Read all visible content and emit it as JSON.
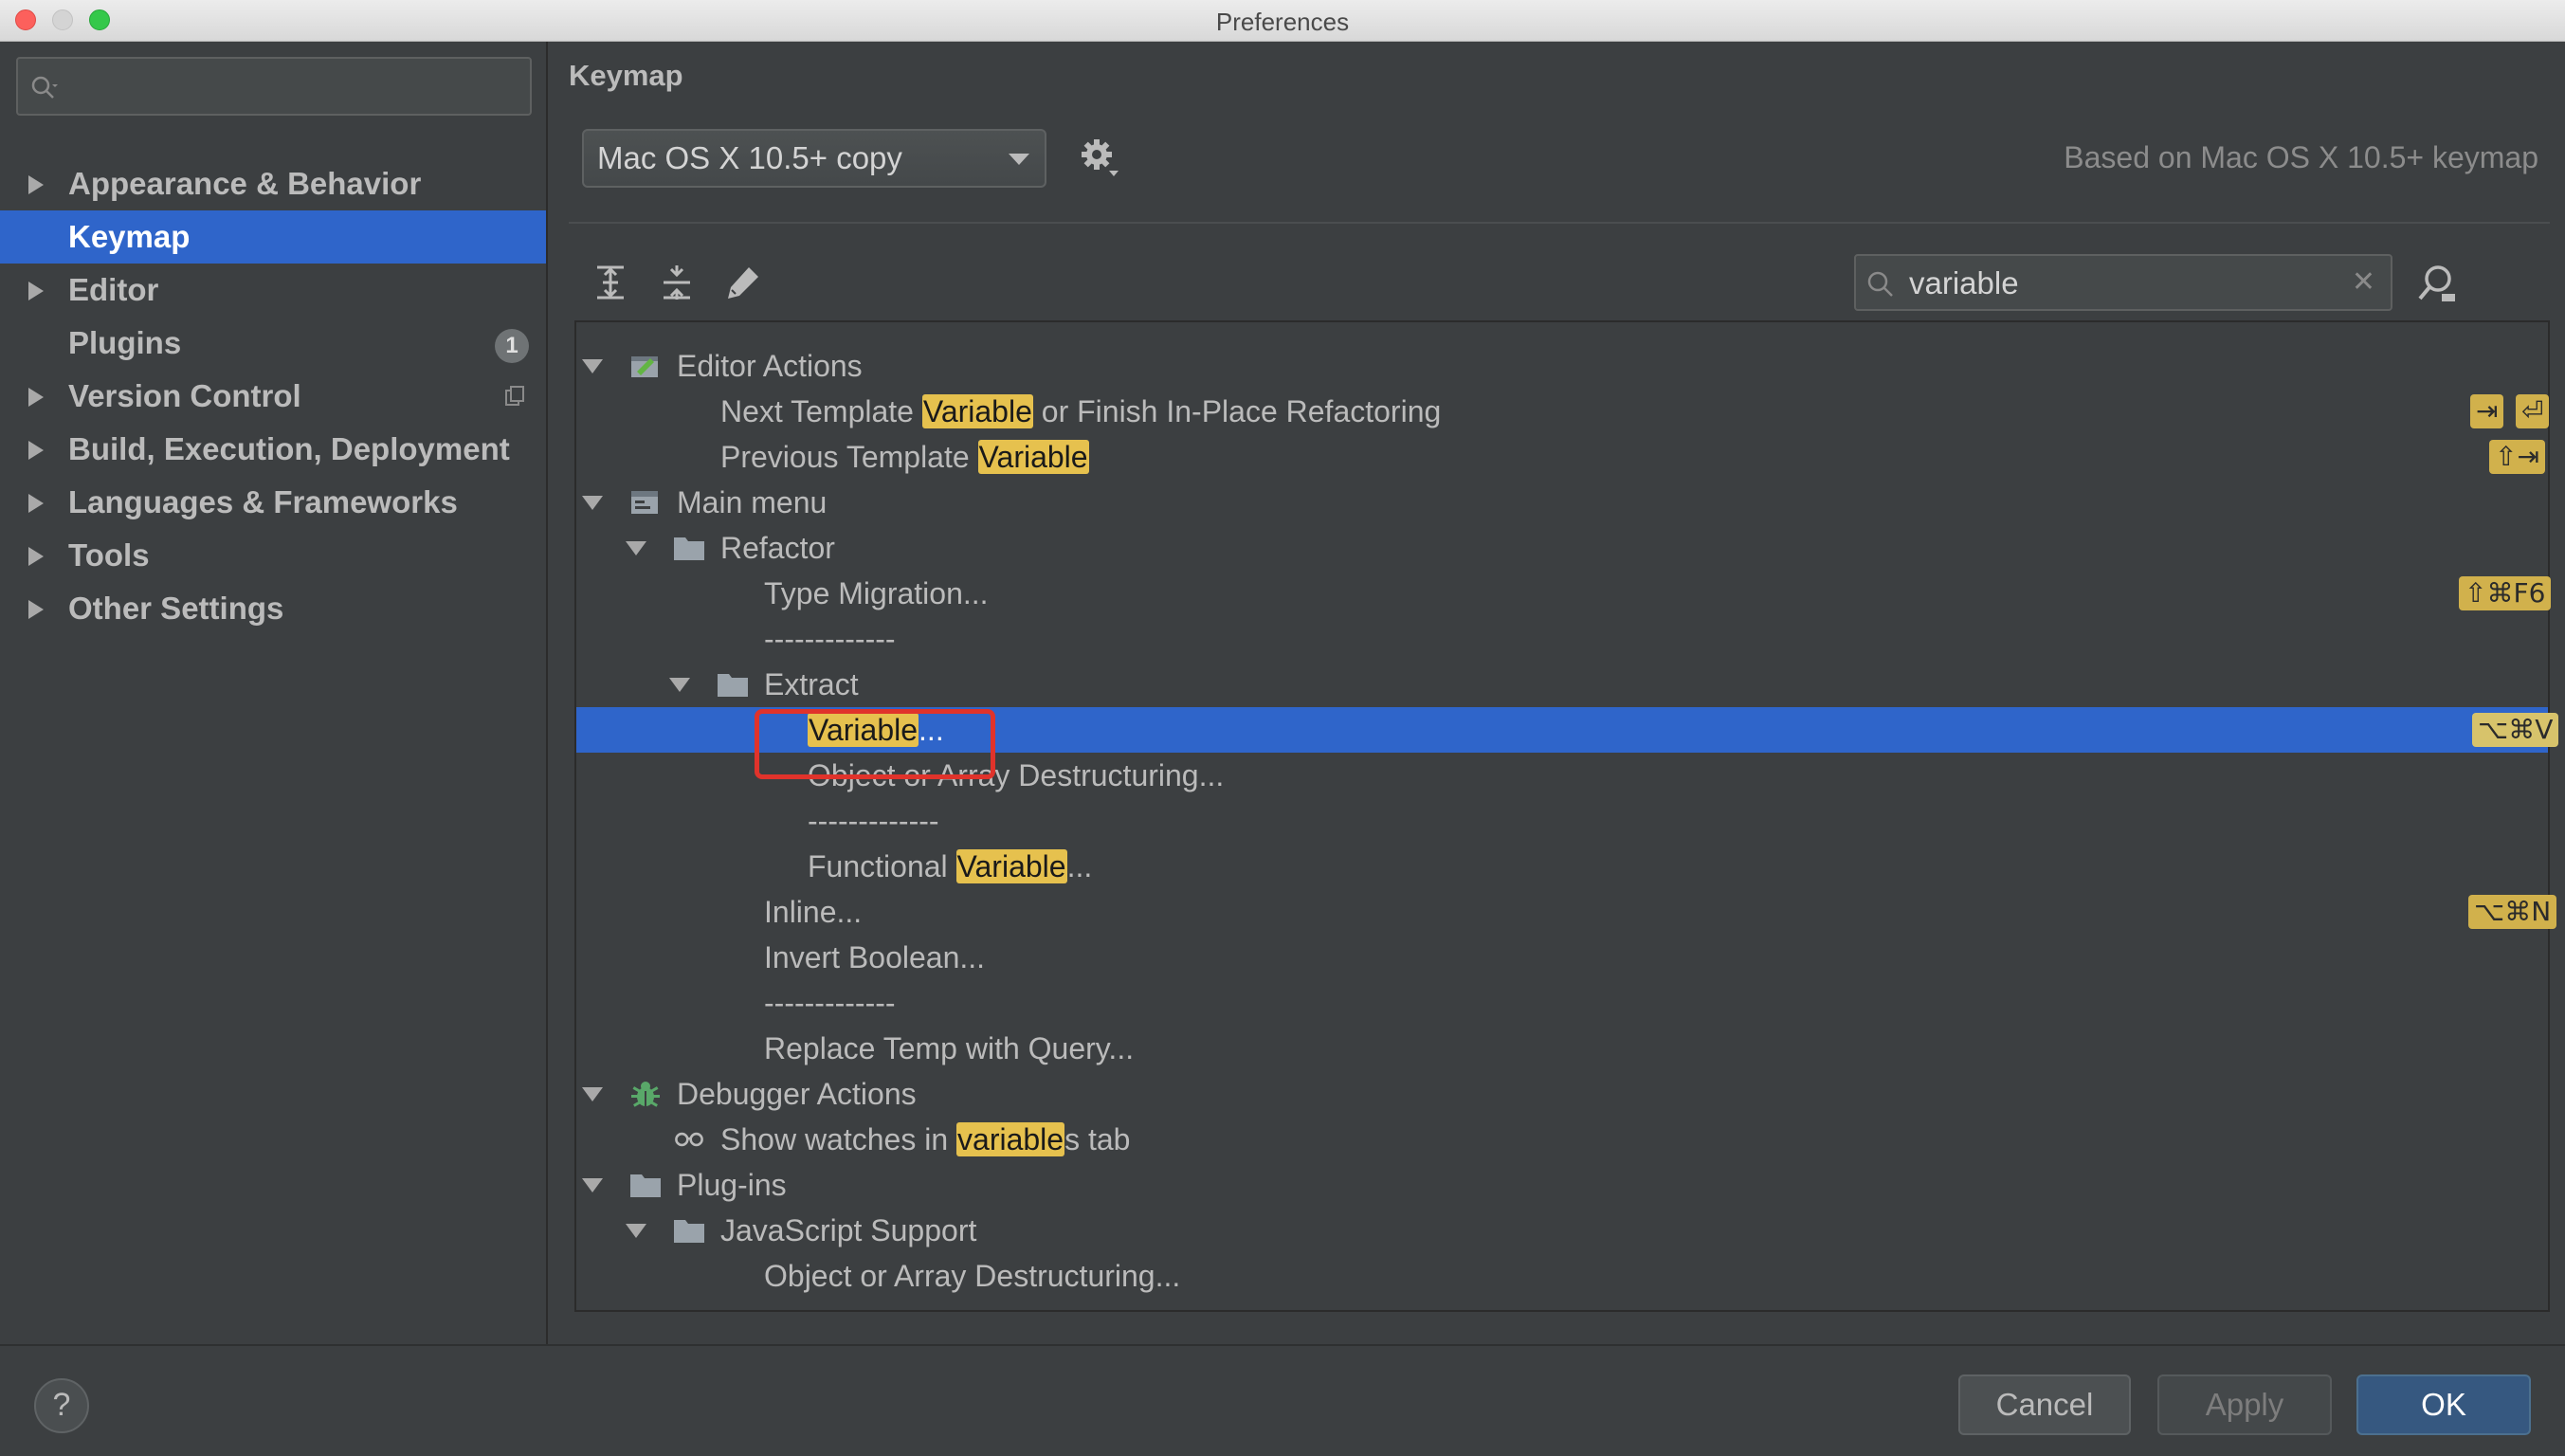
{
  "window": {
    "title": "Preferences"
  },
  "sidebar": {
    "search_placeholder": "",
    "items": [
      {
        "label": "Appearance & Behavior",
        "expandable": true
      },
      {
        "label": "Keymap",
        "selected": true
      },
      {
        "label": "Editor",
        "expandable": true
      },
      {
        "label": "Plugins",
        "badge": "1"
      },
      {
        "label": "Version Control",
        "expandable": true
      },
      {
        "label": "Build, Execution, Deployment",
        "expandable": true
      },
      {
        "label": "Languages & Frameworks",
        "expandable": true
      },
      {
        "label": "Tools",
        "expandable": true
      },
      {
        "label": "Other Settings",
        "expandable": true
      }
    ]
  },
  "main": {
    "heading": "Keymap",
    "keymap_selected": "Mac OS X 10.5+ copy",
    "based_on": "Based on Mac OS X 10.5+ keymap",
    "filter_value": "variable",
    "clear_glyph": "✕"
  },
  "tree": {
    "editor_actions": "Editor Actions",
    "next_template_pre": "Next Template ",
    "next_template_hl": "Variable",
    "next_template_post": " or Finish In-Place Refactoring",
    "next_template_sc1": "⇥",
    "next_template_sc2": "⏎",
    "prev_template_pre": "Previous Template ",
    "prev_template_hl": "Variable",
    "prev_template_sc": "⇧⇥",
    "main_menu": "Main menu",
    "refactor": "Refactor",
    "type_migration": "Type Migration...",
    "type_migration_sc": "⇧⌘F6",
    "separator": "-------------",
    "extract": "Extract",
    "variable_hl": "Variable",
    "variable_post": "...",
    "variable_sc": "⌥⌘V",
    "destructuring": "Object or Array Destructuring...",
    "functional_pre": "Functional ",
    "functional_hl": "Variable",
    "functional_post": "...",
    "inline": "Inline...",
    "inline_sc": "⌥⌘N",
    "invert_boolean": "Invert Boolean...",
    "replace_temp": "Replace Temp with Query...",
    "debugger_actions": "Debugger Actions",
    "show_watches_pre": "Show watches in ",
    "show_watches_hl": "variable",
    "show_watches_post": "s tab",
    "plugins": "Plug-ins",
    "js_support": "JavaScript Support",
    "js_destructuring": "Object or Array Destructuring..."
  },
  "footer": {
    "help": "?",
    "cancel": "Cancel",
    "apply": "Apply",
    "ok": "OK"
  },
  "colors": {
    "selection": "#2f65ca",
    "highlight": "#e6c14e",
    "annotation_box": "#e0332b",
    "ok_button": "#365880"
  }
}
